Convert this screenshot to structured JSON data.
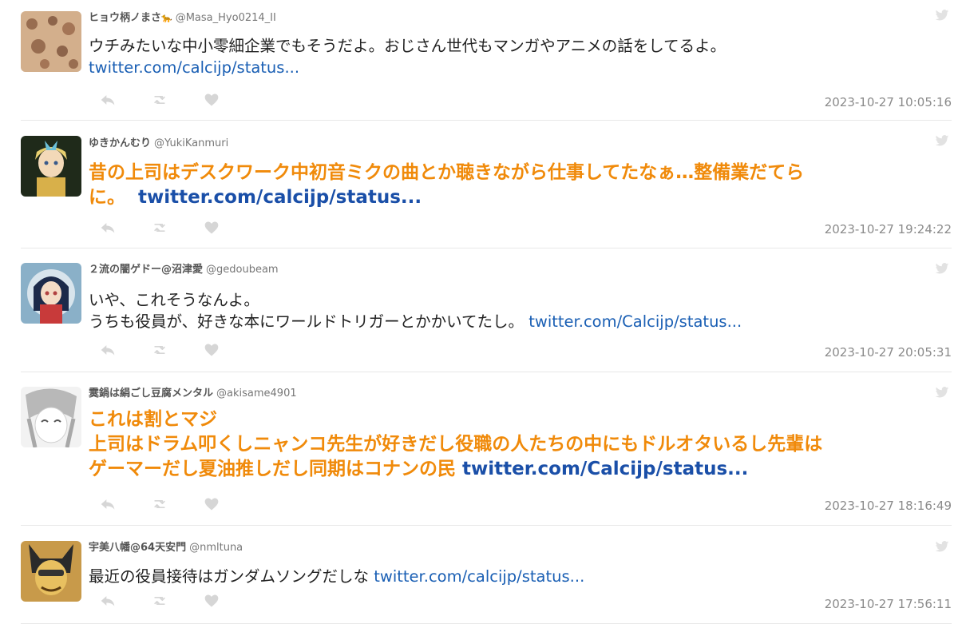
{
  "tweets": [
    {
      "user_name": "ヒョウ柄ノまさ",
      "user_suffix": "🐆",
      "handle": "@Masa_Hyo0214_II",
      "text_lines": [
        "ウチみたいな中小零細企業でもそうだよ。おじさん世代もマンガやアニメの話をしてるよ。"
      ],
      "link": "twitter.com/calcijp/status...",
      "timestamp": "2023-10-27 10:05:16"
    },
    {
      "user_name": "ゆきかんむり",
      "handle": "@YukiKanmuri",
      "text_lines": [
        "昔の上司はデスクワーク中初音ミクの曲とか聴きながら仕事してたなぁ…整備業だてら",
        "に。"
      ],
      "link": "twitter.com/calcijp/status...",
      "timestamp": "2023-10-27 19:24:22"
    },
    {
      "user_name": "２流の闇ゲドー@沼津愛",
      "handle": "@gedoubeam",
      "text_lines": [
        "いや、これそうなんよ。",
        "うちも役員が、好きな本にワールドトリガーとかかいてたし。"
      ],
      "link": "twitter.com/Calcijp/status...",
      "timestamp": "2023-10-27 20:05:31"
    },
    {
      "user_name": "霙鍋は絹ごし豆腐メンタル",
      "handle": "@akisame4901",
      "text_lines": [
        "これは割とマジ",
        "上司はドラム叩くしニャンコ先生が好きだし役職の人たちの中にもドルオタいるし先輩は",
        "ゲーマーだし夏油推しだし同期はコナンの民"
      ],
      "link": "twitter.com/Calcijp/status...",
      "timestamp": "2023-10-27 18:16:49"
    },
    {
      "user_name": "宇美八幡@64天安門",
      "handle": "@nmltuna",
      "text_lines": [
        "最近の役員接待はガンダムソングだしな"
      ],
      "link": "twitter.com/calcijp/status...",
      "timestamp": "2023-10-27 17:56:11"
    }
  ],
  "icons": {
    "reply": "reply-icon",
    "retweet": "retweet-icon",
    "like": "heart-icon",
    "source": "twitter-bird-icon"
  },
  "colors": {
    "highlight_text": "#f08a0a",
    "link": "#1a5fb4",
    "icon": "#d6d6d6",
    "timestamp": "#8a8a8a"
  }
}
